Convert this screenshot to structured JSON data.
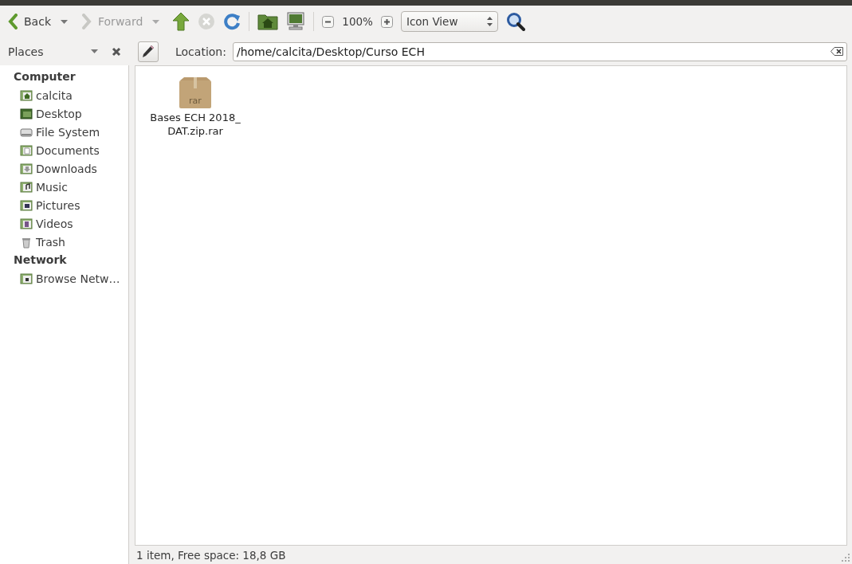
{
  "toolbar": {
    "back": {
      "label": "Back",
      "disabled": false
    },
    "forward": {
      "label": "Forward",
      "disabled": true
    },
    "stop": {
      "disabled": true
    },
    "zoom": "100%",
    "view_mode": "Icon View"
  },
  "side_pane": {
    "title": "Places"
  },
  "location": {
    "label": "Location:",
    "value": "/home/calcita/Desktop/Curso ECH"
  },
  "sidebar": [
    {
      "heading": "Computer",
      "items": [
        {
          "label": "calcita",
          "kind": "home"
        },
        {
          "label": "Desktop",
          "kind": "desktop"
        },
        {
          "label": "File System",
          "kind": "drive"
        },
        {
          "label": "Documents",
          "kind": "documents"
        },
        {
          "label": "Downloads",
          "kind": "downloads"
        },
        {
          "label": "Music",
          "kind": "music"
        },
        {
          "label": "Pictures",
          "kind": "pictures"
        },
        {
          "label": "Videos",
          "kind": "videos"
        },
        {
          "label": "Trash",
          "kind": "trash"
        }
      ]
    },
    {
      "heading": "Network",
      "items": [
        {
          "label": "Browse Netw…",
          "kind": "network"
        }
      ]
    }
  ],
  "files": [
    {
      "name": "Bases ECH 2018_ DAT.zip.rar",
      "icon_label": "rar",
      "selected": false
    }
  ],
  "status_bar": "1 item, Free space: 18,8 GB"
}
